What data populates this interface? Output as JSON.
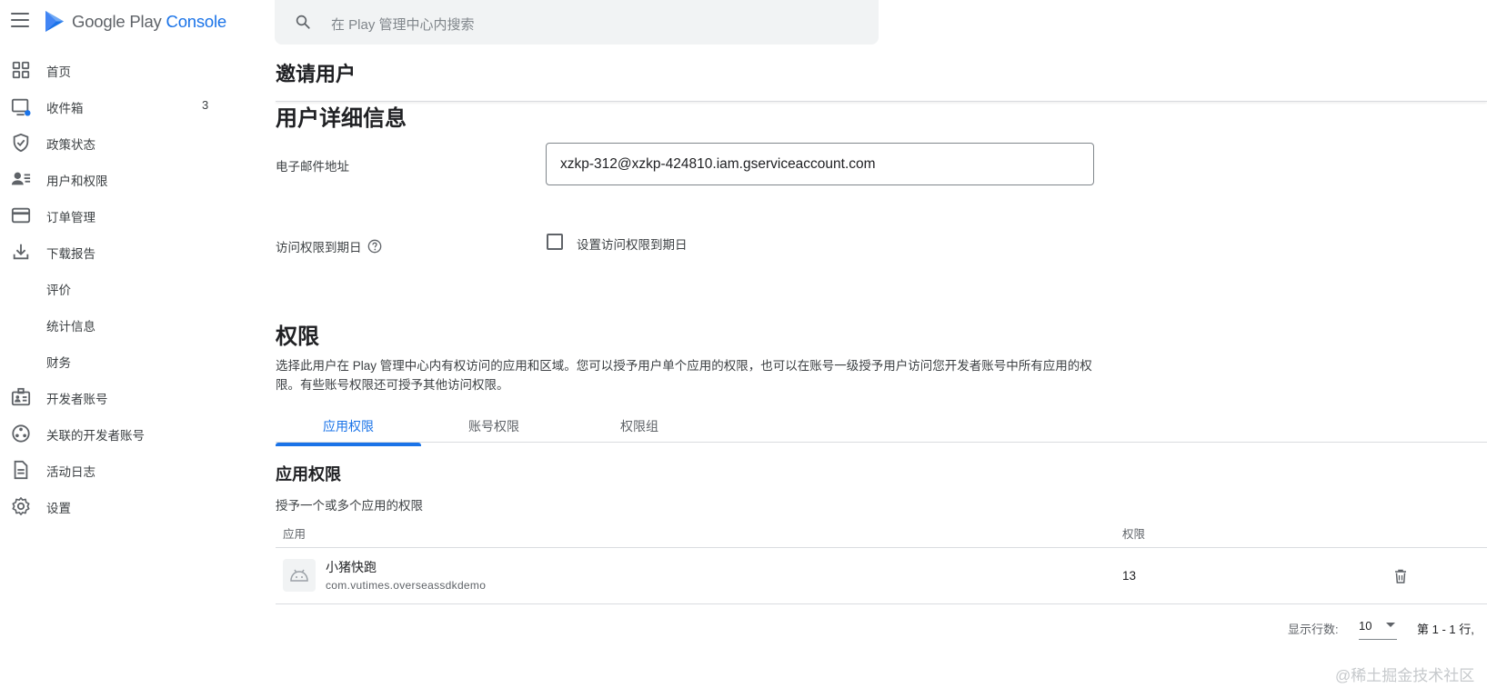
{
  "header": {
    "logo_text_main": "Google Play ",
    "logo_text_accent": "Console",
    "search_placeholder": "在 Play 管理中心内搜索"
  },
  "sidebar": {
    "items": [
      {
        "label": "首页",
        "icon": "dashboard-icon"
      },
      {
        "label": "收件箱",
        "icon": "inbox-icon",
        "count": "3"
      },
      {
        "label": "政策状态",
        "icon": "shield-check-icon"
      },
      {
        "label": "用户和权限",
        "icon": "manage-accounts-icon"
      },
      {
        "label": "订单管理",
        "icon": "credit-card-icon"
      },
      {
        "label": "下载报告",
        "icon": "download-icon"
      },
      {
        "label": "评价",
        "icon": ""
      },
      {
        "label": "统计信息",
        "icon": ""
      },
      {
        "label": "财务",
        "icon": ""
      },
      {
        "label": "开发者账号",
        "icon": "badge-icon"
      },
      {
        "label": "关联的开发者账号",
        "icon": "linked-accounts-icon"
      },
      {
        "label": "活动日志",
        "icon": "document-icon"
      },
      {
        "label": "设置",
        "icon": "gear-icon"
      }
    ]
  },
  "main": {
    "page_title": "邀请用户",
    "section_title": "用户详细信息",
    "email_label": "电子邮件地址",
    "email_value": "xzkp-312@xzkp-424810.iam.gserviceaccount.com",
    "expiry_label": "访问权限到期日",
    "expiry_checkbox_label": "设置访问权限到期日",
    "expiry_checked": false,
    "permissions_title": "权限",
    "permissions_desc": "选择此用户在 Play 管理中心内有权访问的应用和区域。您可以授予用户单个应用的权限，也可以在账号一级授予用户访问您开发者账号中所有应用的权限。有些账号权限还可授予其他访问权限。",
    "tabs": [
      {
        "label": "应用权限",
        "active": true
      },
      {
        "label": "账号权限",
        "active": false
      },
      {
        "label": "权限组",
        "active": false
      }
    ],
    "app_perm_title": "应用权限",
    "app_perm_desc": "授予一个或多个应用的权限",
    "table": {
      "columns": [
        "应用",
        "权限"
      ],
      "rows": [
        {
          "app_name": "小猪快跑",
          "package": "com.vutimes.overseassdkdemo",
          "permissions": "13"
        }
      ]
    },
    "pagination": {
      "rows_label": "显示行数:",
      "rows_value": "10",
      "range": "第 1 - 1 行,"
    }
  },
  "watermark": "@稀土掘金技术社区",
  "colors": {
    "accent": "#1a73e8",
    "text": "#202124",
    "muted": "#5f6368",
    "divider": "#dadce0"
  }
}
